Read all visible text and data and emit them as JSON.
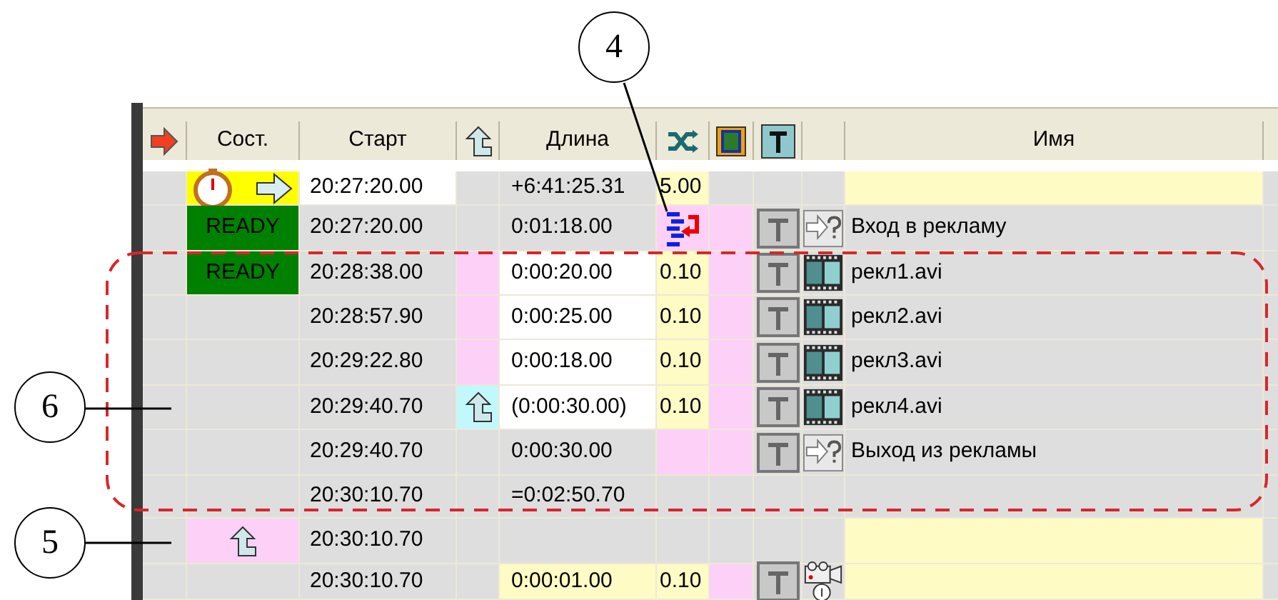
{
  "table": {
    "header": {
      "state": "Сост.",
      "start": "Старт",
      "length": "Длина",
      "name": "Имя"
    },
    "rows": [
      {
        "kind": "timer",
        "start": "20:27:20.00",
        "length": "+6:41:25.31",
        "transition": "5.00"
      },
      {
        "kind": "block_start",
        "state": "READY",
        "start": "20:27:20.00",
        "length": "0:01:18.00",
        "name": "Вход в рекламу"
      },
      {
        "kind": "clip",
        "state": "READY",
        "start": "20:28:38.00",
        "length": "0:00:20.00",
        "transition": "0.10",
        "name": "рекл1.avi",
        "return_point": false
      },
      {
        "kind": "clip",
        "start": "20:28:57.90",
        "length": "0:00:25.00",
        "transition": "0.10",
        "name": "рекл2.avi",
        "return_point": false
      },
      {
        "kind": "clip",
        "start": "20:29:22.80",
        "length": "0:00:18.00",
        "transition": "0.10",
        "name": "рекл3.avi",
        "return_point": false
      },
      {
        "kind": "clip",
        "start": "20:29:40.70",
        "length": "(0:00:30.00)",
        "transition": "0.10",
        "name": "рекл4.avi",
        "return_point": true
      },
      {
        "kind": "block_end",
        "start": "20:29:40.70",
        "length": "0:00:30.00",
        "name": "Выход из рекламы"
      },
      {
        "kind": "block_total",
        "start": "20:30:10.70",
        "length": "=0:02:50.70"
      },
      {
        "kind": "return",
        "start": "20:30:10.70"
      },
      {
        "kind": "camera",
        "start": "20:30:10.70",
        "length": "0:00:01.00",
        "transition": "0.10"
      }
    ]
  },
  "callouts": [
    {
      "label": "4"
    },
    {
      "label": "6"
    },
    {
      "label": "5"
    }
  ]
}
